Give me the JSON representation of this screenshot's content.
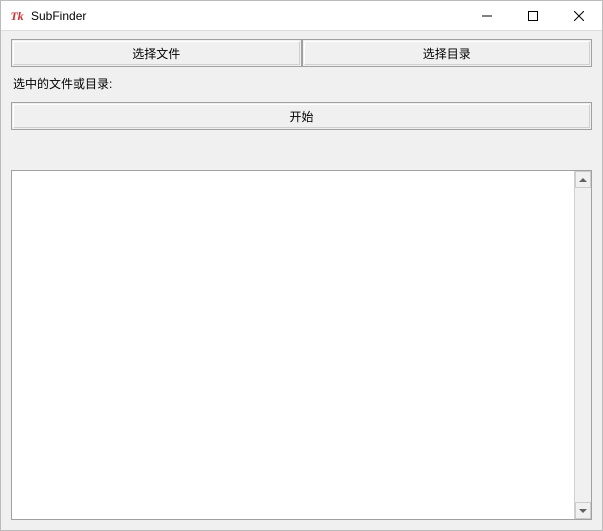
{
  "window": {
    "title": "SubFinder",
    "icon_name": "tk-logo-icon"
  },
  "buttons": {
    "select_file": "选择文件",
    "select_dir": "选择目录",
    "start": "开始"
  },
  "labels": {
    "selected_path": "选中的文件或目录:"
  },
  "output": {
    "text": ""
  }
}
